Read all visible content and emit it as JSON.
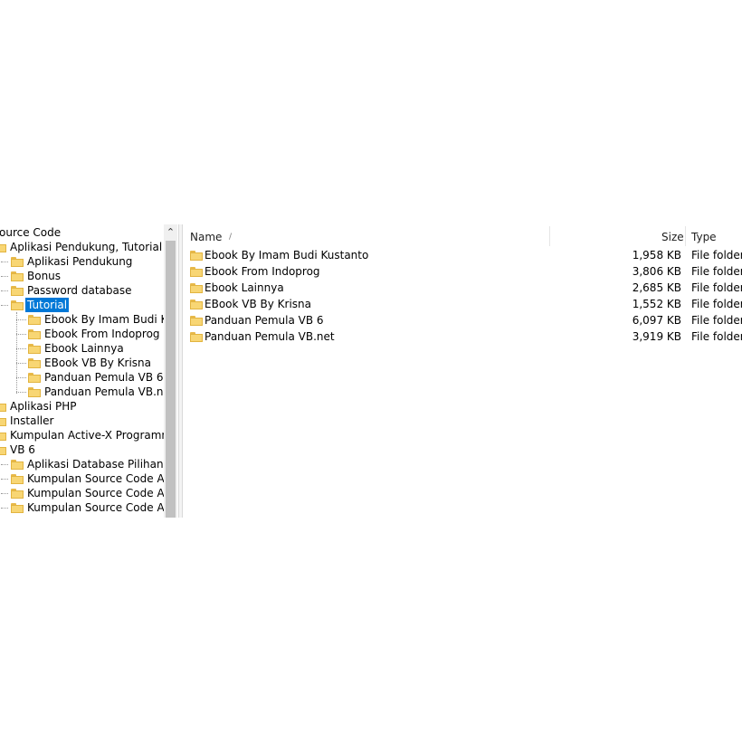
{
  "tree": {
    "items": [
      {
        "label": "ource Code",
        "depth": 0,
        "selected": false
      },
      {
        "label": "Aplikasi Pendukung, Tutorial & I",
        "depth": 0,
        "selected": false
      },
      {
        "label": "Aplikasi Pendukung",
        "depth": 1,
        "selected": false
      },
      {
        "label": "Bonus",
        "depth": 1,
        "selected": false
      },
      {
        "label": "Password database",
        "depth": 1,
        "selected": false
      },
      {
        "label": "Tutorial",
        "depth": 1,
        "selected": true
      },
      {
        "label": "Ebook By Imam Budi Kus",
        "depth": 2,
        "selected": false
      },
      {
        "label": "Ebook From Indoprog",
        "depth": 2,
        "selected": false
      },
      {
        "label": "Ebook Lainnya",
        "depth": 2,
        "selected": false
      },
      {
        "label": "EBook VB By Krisna",
        "depth": 2,
        "selected": false
      },
      {
        "label": "Panduan Pemula VB 6",
        "depth": 2,
        "selected": false
      },
      {
        "label": "Panduan Pemula VB.net",
        "depth": 2,
        "selected": false
      },
      {
        "label": "Aplikasi PHP",
        "depth": 0,
        "selected": false
      },
      {
        "label": "Installer",
        "depth": 0,
        "selected": false
      },
      {
        "label": "Kumpulan Active-X Programmin",
        "depth": 0,
        "selected": false
      },
      {
        "label": "VB 6",
        "depth": 0,
        "selected": false
      },
      {
        "label": "Aplikasi Database Pilihan",
        "depth": 1,
        "selected": false
      },
      {
        "label": "Kumpulan Source Code Aplil",
        "depth": 1,
        "selected": false
      },
      {
        "label": "Kumpulan Source Code Aplil",
        "depth": 1,
        "selected": false
      },
      {
        "label": "Kumpulan Source Code Aplil",
        "depth": 1,
        "selected": false
      }
    ],
    "scroll_up_icon": "chevron-up-icon"
  },
  "list": {
    "columns": {
      "name": "Name",
      "size": "Size",
      "type": "Type"
    },
    "sort_indicator": "/",
    "rows": [
      {
        "name": "Ebook By Imam Budi Kustanto",
        "size": "1,958 KB",
        "type": "File folder"
      },
      {
        "name": "Ebook From Indoprog",
        "size": "3,806 KB",
        "type": "File folder"
      },
      {
        "name": "Ebook Lainnya",
        "size": "2,685 KB",
        "type": "File folder"
      },
      {
        "name": "EBook VB By Krisna",
        "size": "1,552 KB",
        "type": "File folder"
      },
      {
        "name": "Panduan Pemula VB 6",
        "size": "6,097 KB",
        "type": "File folder"
      },
      {
        "name": "Panduan Pemula VB.net",
        "size": "3,919 KB",
        "type": "File folder"
      }
    ]
  },
  "colors": {
    "selection": "#0078d7",
    "folder": "#f8d674"
  }
}
